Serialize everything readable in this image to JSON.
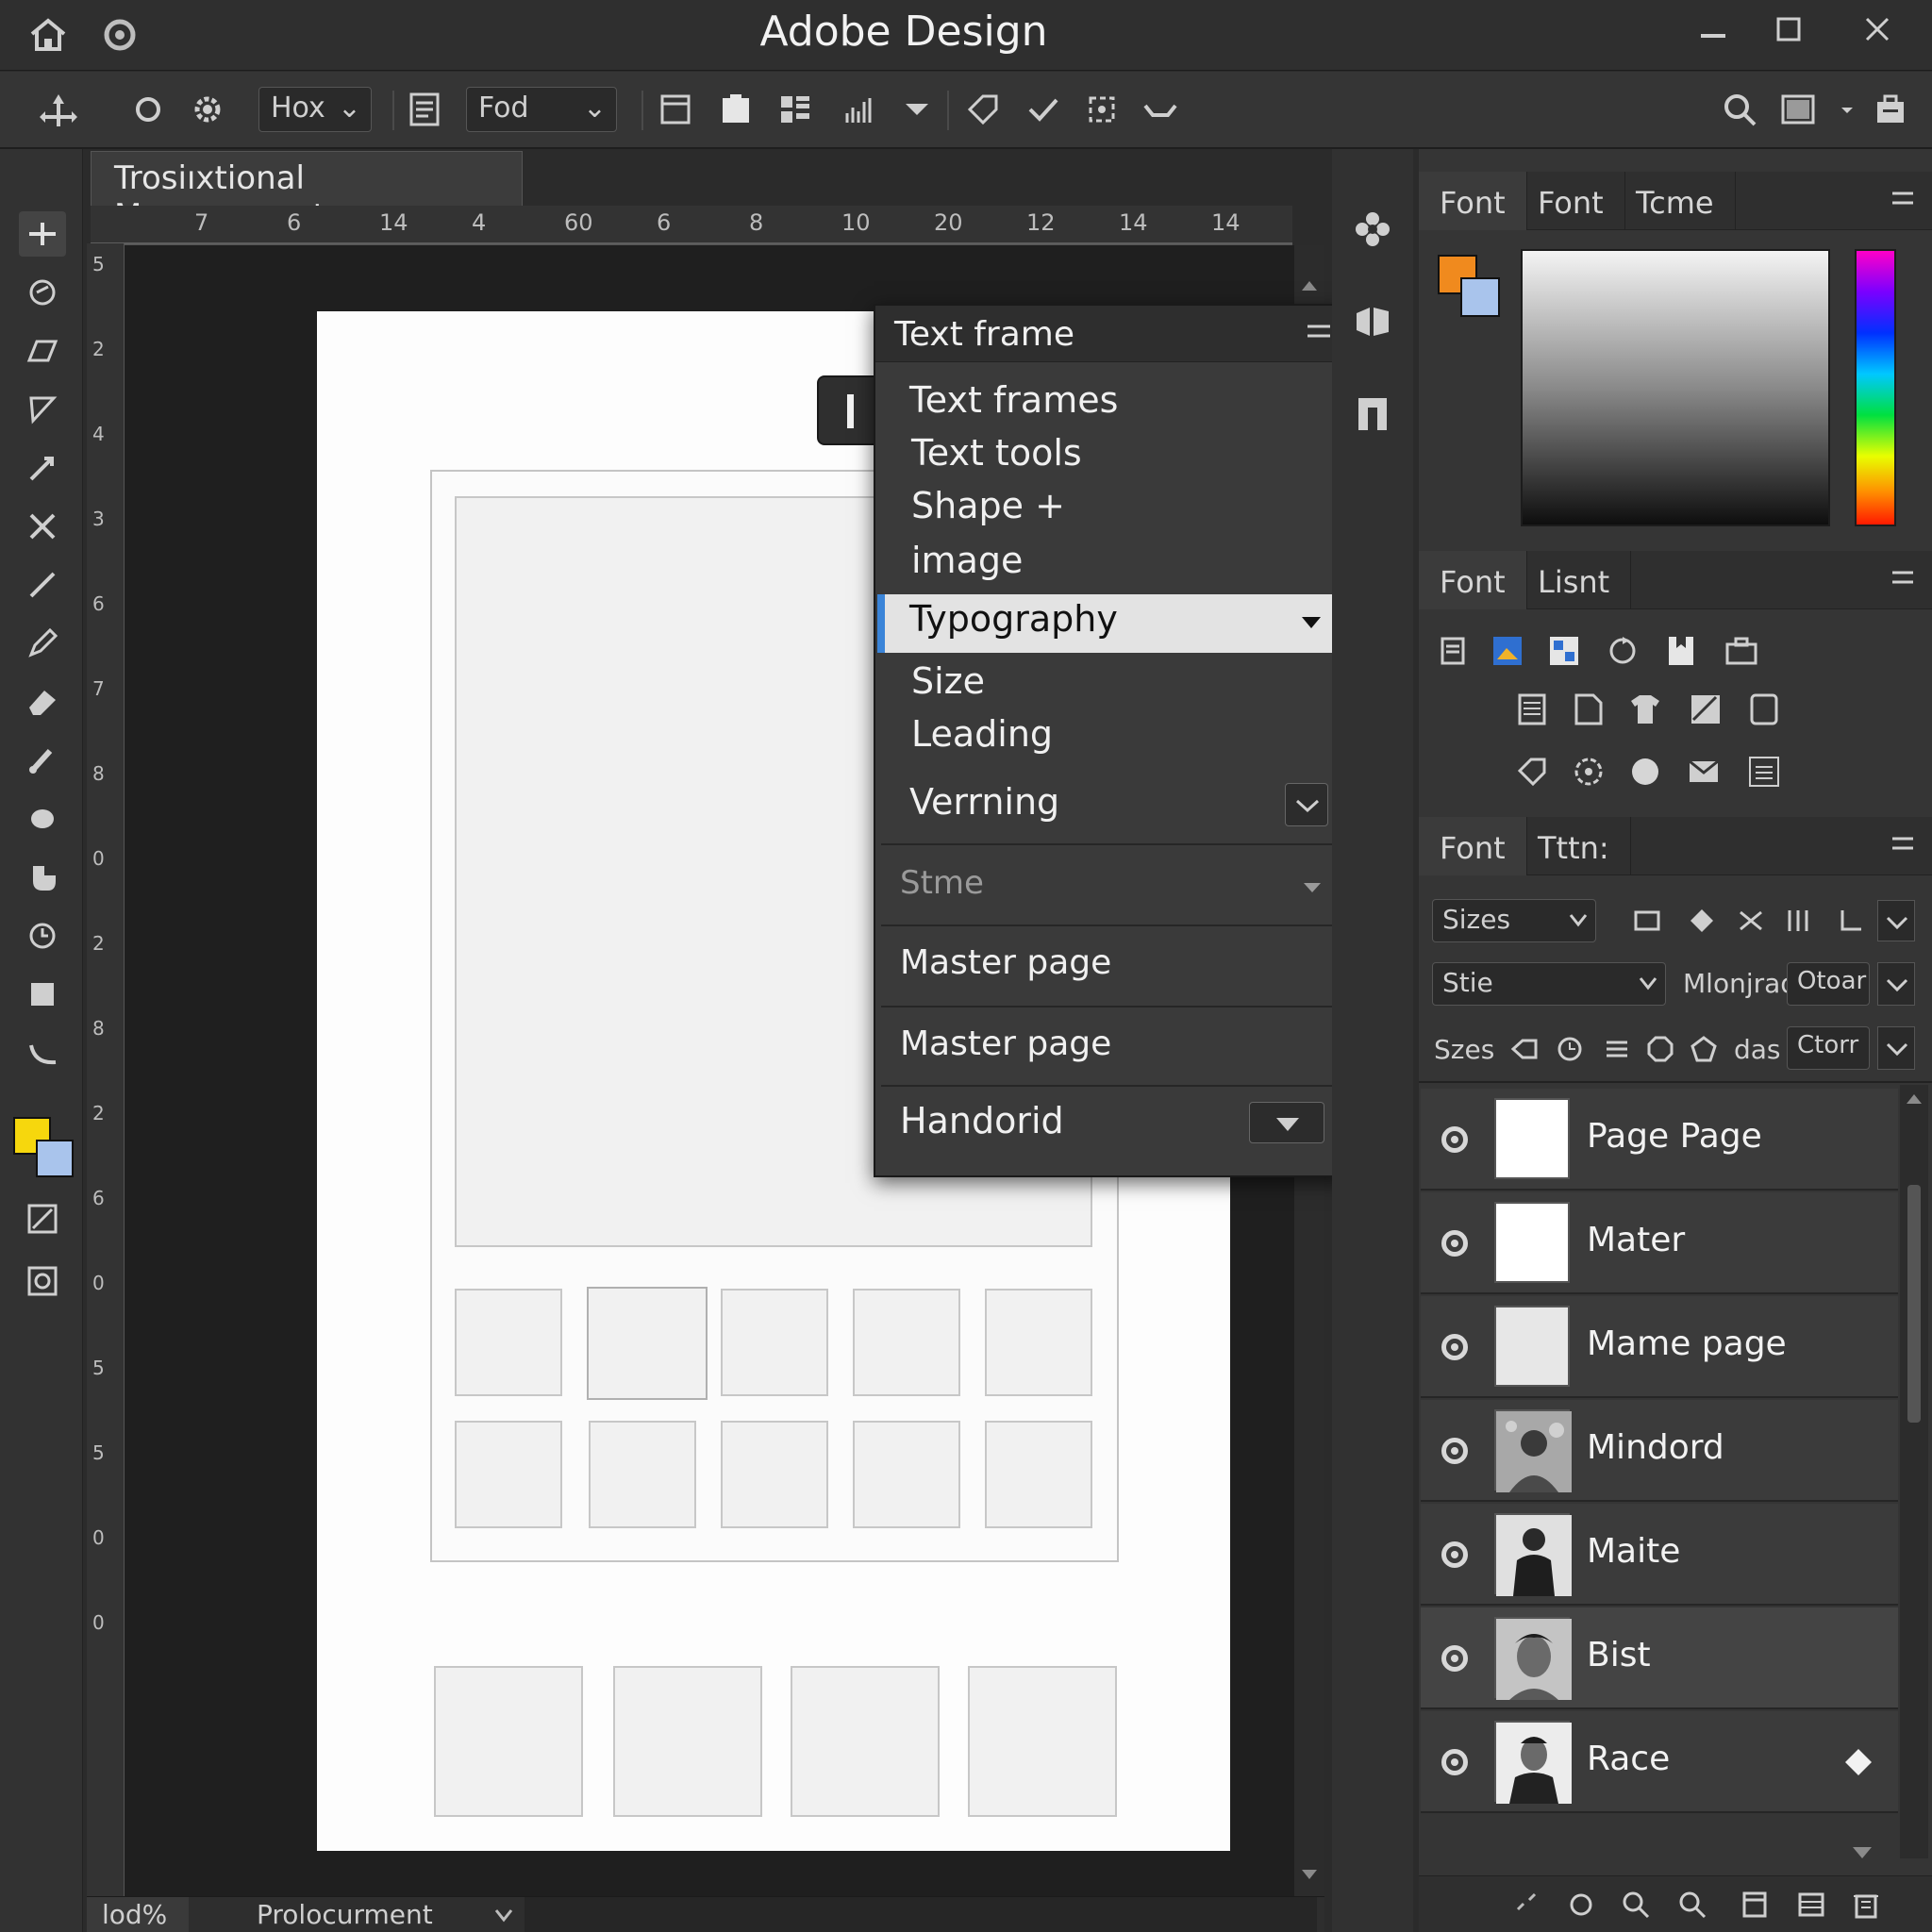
{
  "app": {
    "title": "Adobe Design"
  },
  "toolbar": {
    "dropdown1": "Hox",
    "dropdown2": "Fod"
  },
  "document": {
    "tab": "Trosiıxtional Management",
    "ruler_top": [
      "7",
      "6",
      "14",
      "4",
      "60",
      "6",
      "8",
      "10",
      "20",
      "12",
      "14",
      "14"
    ],
    "ruler_left": [
      "5",
      "2",
      "4",
      "3",
      "6",
      "7",
      "8",
      "0",
      "2",
      "8",
      "2",
      "6",
      "0",
      "5",
      "5",
      "0",
      "0"
    ]
  },
  "statusbar": {
    "zoom": "lod%",
    "doc": "Prolocurment"
  },
  "menu": {
    "header": "Text frame",
    "items": [
      "Text frames",
      "Text tools",
      "Shape +",
      "image",
      "Typography",
      "Size",
      "Leading",
      "Verrning"
    ],
    "section2": "Stme",
    "master1": "Master page",
    "master2": "Master page",
    "handorid": "Handorid"
  },
  "panels": {
    "color": {
      "tabs": [
        "Font",
        "Font",
        "Tcme"
      ],
      "fg_color": "#f08a1e",
      "bg_color": "#a9c4ec"
    },
    "glyph": {
      "tabs": [
        "Font",
        "Lisnt"
      ]
    },
    "char": {
      "tabs": [
        "Font",
        "Tttn:"
      ],
      "sizes_dd": "Sizes",
      "style_dd": "Stie",
      "label_mid": "Mlonjrad",
      "opt1": "Otoar",
      "row3_label": "Szes",
      "row3_text": "das",
      "opt2": "Ctorr"
    }
  },
  "layers": [
    {
      "name": "Page Page",
      "thumb": "blank"
    },
    {
      "name": "Mater",
      "thumb": "blank"
    },
    {
      "name": "Mame page",
      "thumb": "grey"
    },
    {
      "name": "Mindord",
      "thumb": "photo"
    },
    {
      "name": "Maite",
      "thumb": "photo"
    },
    {
      "name": "Bist",
      "thumb": "photo"
    },
    {
      "name": "Race",
      "thumb": "photo"
    }
  ],
  "colors": {
    "fill_swatch": "#f6d70d",
    "stroke_swatch": "#a9c4ec",
    "accent": "#3a84d8"
  }
}
